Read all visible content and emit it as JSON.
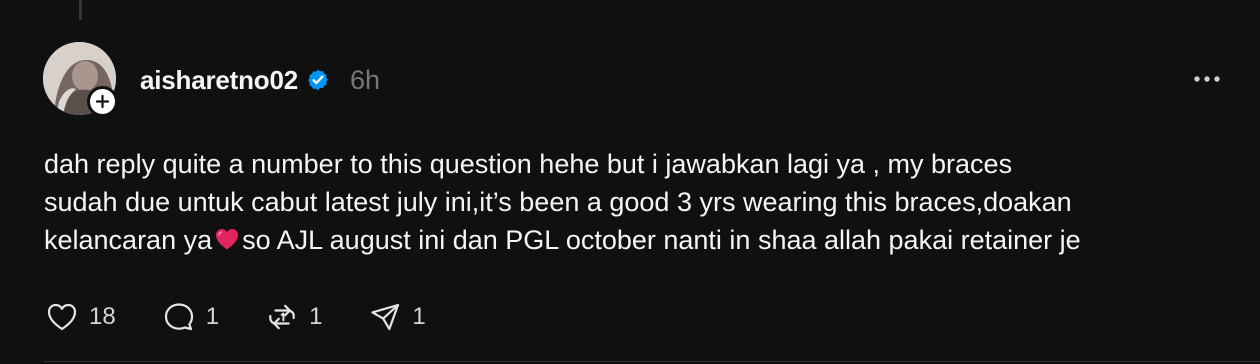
{
  "post": {
    "username": "aisharetno02",
    "timestamp": "6h",
    "verified": true,
    "body_lines": [
      "dah reply quite a number to this question hehe but i jawabkan lagi ya , my braces",
      "sudah due untuk cabut latest july ini,it’s been a good 3 yrs wearing this braces,doakan",
      "kelancaran ya",
      "so AJL august ini dan PGL october nanti in shaa allah pakai retainer je"
    ],
    "emoji": "red-heart",
    "actions": {
      "likes": "18",
      "replies": "1",
      "reposts": "1",
      "shares": "1"
    }
  },
  "icons": {
    "follow": "plus-icon",
    "verified": "verified-badge-icon",
    "more": "more-horizontal-icon",
    "like": "heart-outline-icon",
    "reply": "speech-bubble-icon",
    "repost": "repost-icon",
    "share": "send-icon"
  },
  "colors": {
    "background": "#101010",
    "text": "#f3f5f7",
    "muted": "#777777",
    "verified": "#0095f6",
    "heart": "#e0245e"
  }
}
